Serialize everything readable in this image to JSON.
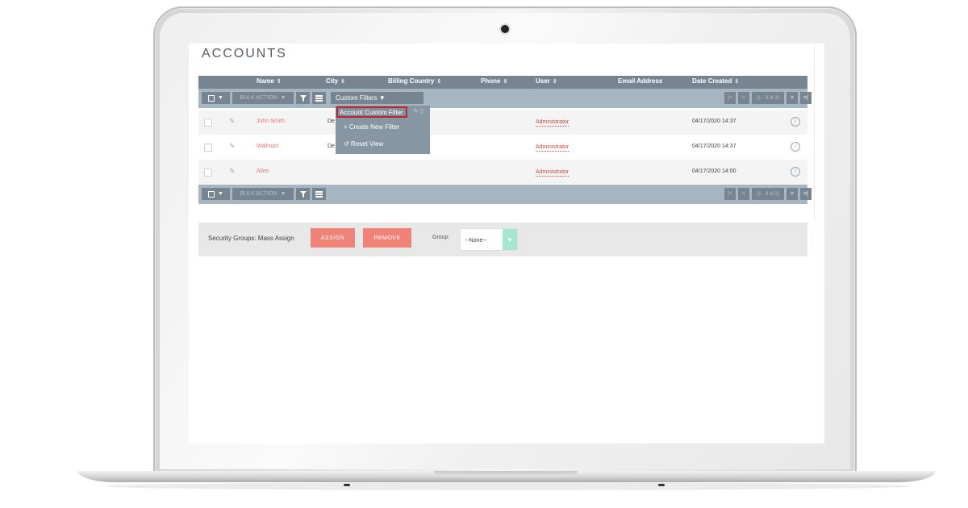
{
  "page": {
    "title": "ACCOUNTS"
  },
  "columns": {
    "name": "Name",
    "city": "City",
    "billing_country": "Billing Country",
    "phone": "Phone",
    "user": "User",
    "email": "Email Address",
    "date_created": "Date Created",
    "sort_glyph": "⇕"
  },
  "toolbar": {
    "bulk_action": "BULK ACTION",
    "bulk_caret": "▼",
    "select_caret": "▼",
    "custom_filters": "Custom Filters ▼",
    "pager": {
      "first": "|<",
      "prev": "<",
      "range": "(1 - 3 of 3)",
      "next": ">",
      "last": ">|"
    }
  },
  "filter_dropdown": {
    "selected": "Account Custom Filter",
    "create": "+ Create New Filter",
    "reset": "↺ Reset View"
  },
  "rows": [
    {
      "name": "John Smith",
      "city": "De",
      "user": "Administrator",
      "date": "04/17/2020 14:37"
    },
    {
      "name": "Wallmart",
      "city": "De",
      "user": "Administrator",
      "date": "04/17/2020 14:37"
    },
    {
      "name": "Allen",
      "city": "",
      "user": "Administrator",
      "date": "04/17/2020 14:00"
    }
  ],
  "mass_assign": {
    "label": "Security Groups: Mass Assign",
    "assign": "ASSIGN",
    "remove": "REMOVE",
    "group_label": "Group:",
    "group_value": "--None--"
  },
  "colors": {
    "header": "#778591",
    "toolbar": "#a5b5c1",
    "accent_red": "#f08377",
    "link": "#e9796d",
    "highlight_border": "#c0232b"
  },
  "icons": [
    "checkbox-icon",
    "filter-icon",
    "column-chooser-icon",
    "pencil-icon",
    "info-icon",
    "caret-down-icon"
  ]
}
